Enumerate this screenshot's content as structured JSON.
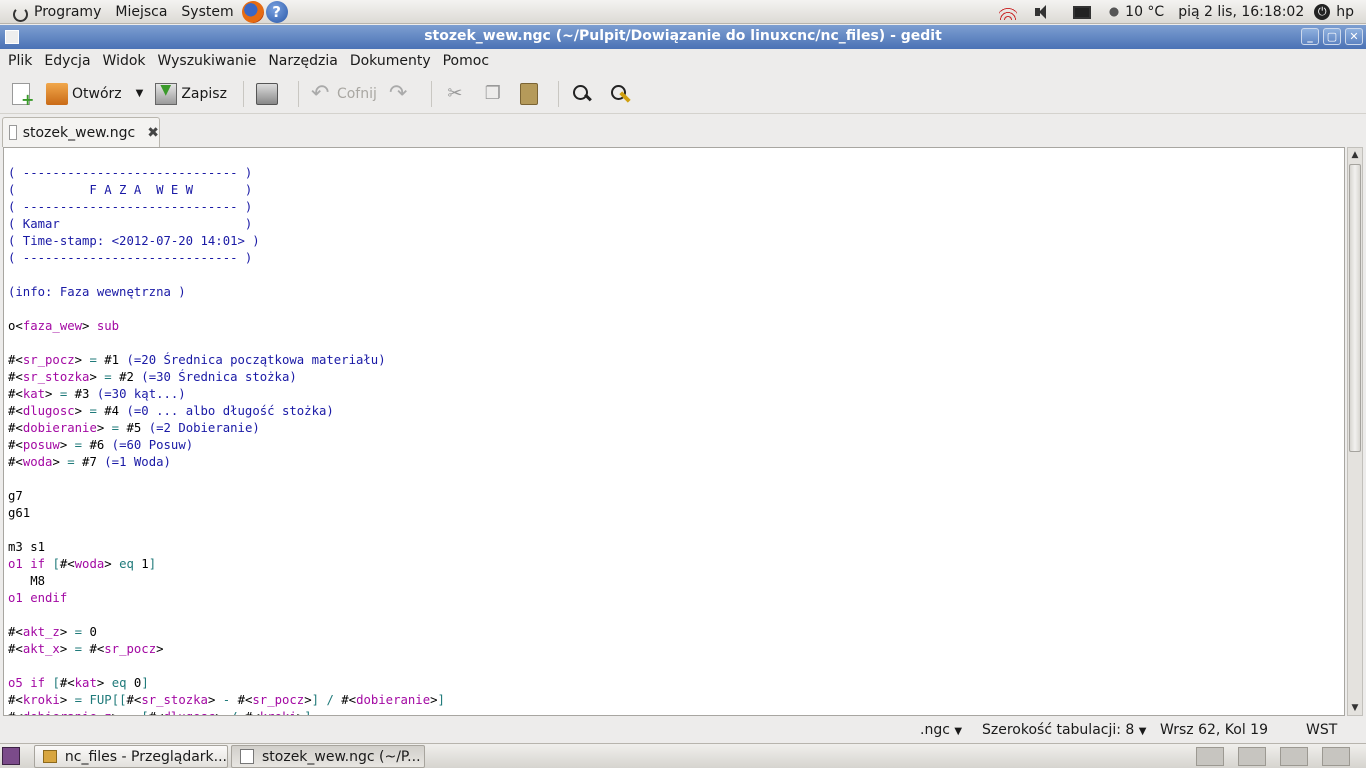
{
  "top_panel": {
    "menus": [
      "Programy",
      "Miejsca",
      "System"
    ],
    "weather": "10 °C",
    "clock": "pią  2 lis, 16:18:02",
    "user": "hp"
  },
  "window": {
    "title": "stozek_wew.ngc (~/Pulpit/Dowiązanie do linuxcnc/nc_files) - gedit"
  },
  "menubar": [
    "Plik",
    "Edycja",
    "Widok",
    "Wyszukiwanie",
    "Narzędzia",
    "Dokumenty",
    "Pomoc"
  ],
  "toolbar": {
    "open_label": "Otwórz",
    "save_label": "Zapisz",
    "undo_label": "Cofnij"
  },
  "tab": {
    "filename": "stozek_wew.ngc"
  },
  "code_lines": [
    "( ----------------------------- )",
    "(          F A Z A  W E W       )",
    "( ----------------------------- )",
    "( Kamar                         )",
    "( Time-stamp: <2012-07-20 14:01> )",
    "( ----------------------------- )",
    "",
    "(info: Faza wewnętrzna )",
    "",
    "o<faza_wew> sub",
    "",
    "#<sr_pocz> = #1 (=20 Średnica początkowa materiału)",
    "#<sr_stozka> = #2 (=30 Średnica stożka)",
    "#<kat> = #3 (=30 kąt...)",
    "#<dlugosc> = #4 (=0 ... albo długość stożka)",
    "#<dobieranie> = #5 (=2 Dobieranie)",
    "#<posuw> = #6 (=60 Posuw)",
    "#<woda> = #7 (=1 Woda)",
    "",
    "g7",
    "g61",
    "",
    "m3 s1",
    "o1 if [#<woda> eq 1]",
    "   M8",
    "o1 endif",
    "",
    "#<akt_z> = 0",
    "#<akt_x> = #<sr_pocz>",
    "",
    "o5 if [#<kat> eq 0]",
    "#<kroki> = FUP[[#<sr_stozka> - #<sr_pocz>] / #<dobieranie>]",
    "#<dobieranie_z> = [#<dlugosc> / #<kroki>]"
  ],
  "statusbar": {
    "language": ".ngc",
    "tab_width": "Szerokość tabulacji:  8",
    "position": "Wrsz 62, Kol 19",
    "mode": "WST"
  },
  "taskbar": {
    "items": [
      "nc_files - Przeglądark...",
      "stozek_wew.ngc (~/P..."
    ]
  },
  "colors": {
    "titlebar": "#5a80bf",
    "comment": "#1a1aa6",
    "keyword": "#a309a3",
    "operator": "#1f7a7a"
  }
}
